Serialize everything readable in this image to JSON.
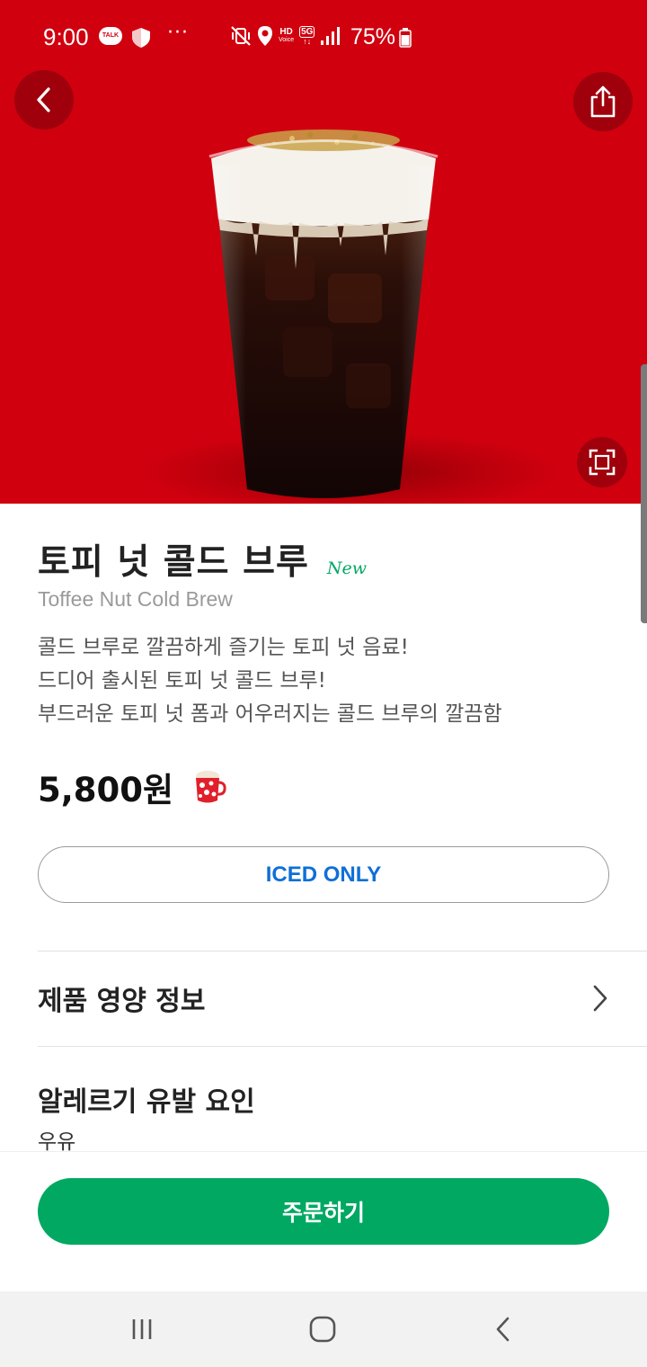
{
  "status_bar": {
    "time": "9:00",
    "talk_badge": "TALK",
    "dots": "···",
    "hd_top": "HD",
    "hd_bottom": "Voice",
    "network": "5G",
    "battery": "75%",
    "icons": [
      "kakaotalk-icon",
      "shield-icon",
      "mute-vibrate-icon",
      "location-icon",
      "hd-voice-icon",
      "5g-icon",
      "signal-icon",
      "battery-icon"
    ]
  },
  "hero": {
    "background_color": "#d0000f",
    "icons": [
      "back-icon",
      "share-icon",
      "expand-icon"
    ]
  },
  "product": {
    "name": "토피 넛 콜드 브루",
    "badge": "New",
    "name_en": "Toffee Nut Cold Brew",
    "description": [
      "콜드 브루로 깔끔하게 즐기는 토피 넛 음료!",
      "드디어 출시된 토피 넛 콜드 브루!",
      "부드러운 토피 넛 폼과 어우러지는 콜드 브루의 깔끔함"
    ],
    "price": "5,800원",
    "temperature_option": "ICED ONLY"
  },
  "sections": {
    "nutrition_label": "제품 영양 정보",
    "allergy_label": "알레르기 유발 요인",
    "allergy_value": "우유"
  },
  "order_button_label": "주문하기",
  "colors": {
    "accent_green": "#00a862",
    "option_blue": "#0e6fd8",
    "hero_red": "#d0000f"
  },
  "nav_bar": {
    "icons": [
      "recent-apps-icon",
      "home-icon",
      "back-nav-icon"
    ]
  }
}
